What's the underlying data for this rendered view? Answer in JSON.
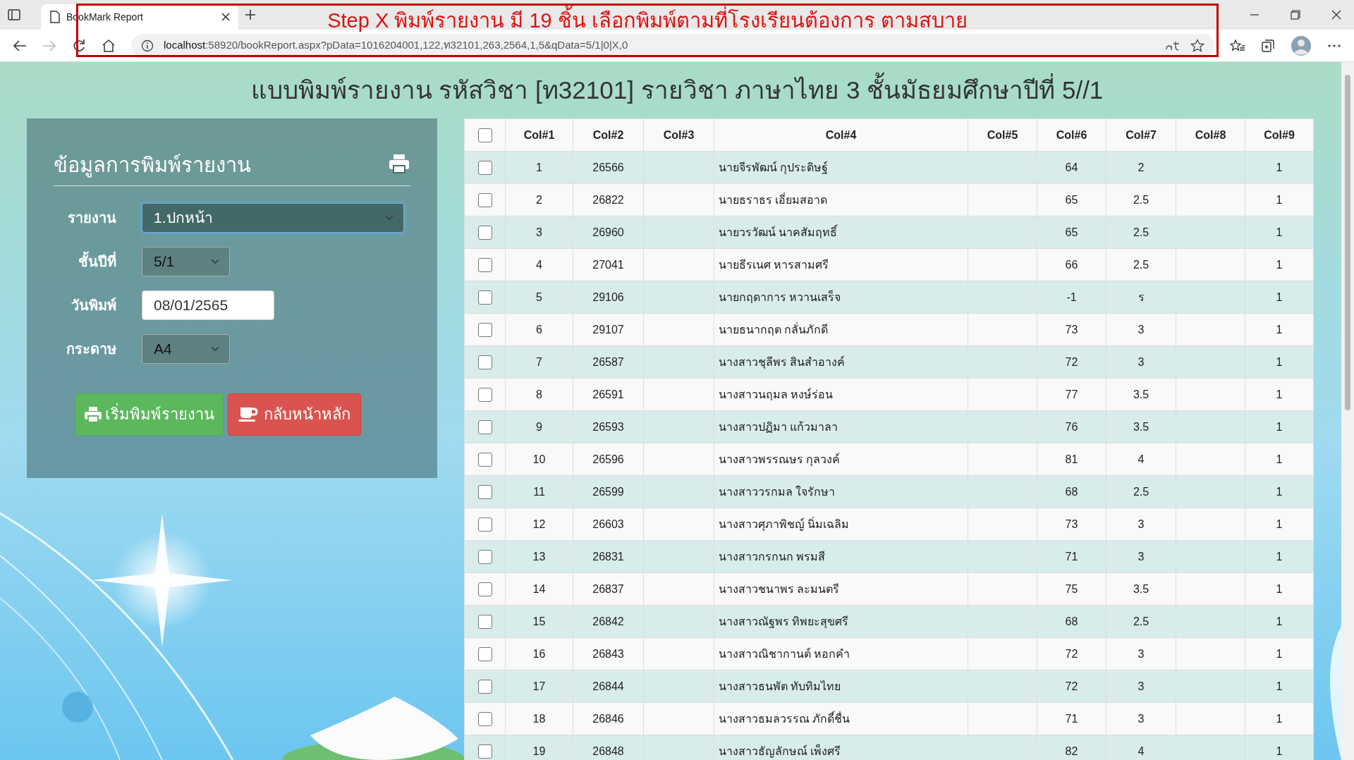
{
  "browser": {
    "tab_title": "BookMark Report",
    "url_host": "localhost",
    "url_rest": ":58920/bookReport.aspx?pData=1016204001,122,ท32101,263,2564,1,5&qData=5/1|0|X,0",
    "forward_disabled": true
  },
  "annotation": "Step X พิมพ์รายงาน มี 19 ชิ้น เลือกพิมพ์ตามที่โรงเรียนต้องการ ตามสบาย",
  "page_title": "แบบพิมพ์รายงาน รหัสวิชา [ท32101] รายวิชา ภาษาไทย 3 ชั้นมัธยมศึกษาปีที่ 5//1",
  "panel": {
    "title": "ข้อมูลการพิมพ์รายงาน",
    "fields": [
      {
        "kind": "select",
        "label": "รายงาน",
        "value": "1.ปกหน้า",
        "focused": true
      },
      {
        "kind": "select",
        "label": "ชั้นปีที่",
        "value": "5/1",
        "focused": false
      },
      {
        "kind": "date",
        "label": "วันพิมพ์",
        "value": "08/01/2565",
        "focused": false
      },
      {
        "kind": "select",
        "label": "กระดาษ",
        "value": "A4",
        "focused": false
      }
    ],
    "buttons": [
      {
        "kind": "print",
        "label": "เริ่มพิมพ์รายงาน"
      },
      {
        "kind": "home",
        "label": "กลับหน้าหลัก"
      }
    ]
  },
  "table": {
    "select_all_checked": false,
    "columns": [
      "Col#1",
      "Col#2",
      "Col#3",
      "Col#4",
      "Col#5",
      "Col#6",
      "Col#7",
      "Col#8",
      "Col#9"
    ],
    "rows": [
      {
        "checked": false,
        "col_1": "1",
        "col_2": "26566",
        "col_4": "นายจีรพัฒน์ กุประดิษฐ์",
        "col_6": "64",
        "col_7": "2",
        "col_9": "1"
      },
      {
        "checked": false,
        "col_1": "2",
        "col_2": "26822",
        "col_4": "นายธราธร เอี่ยมสอาด",
        "col_6": "65",
        "col_7": "2.5",
        "col_9": "1"
      },
      {
        "checked": false,
        "col_1": "3",
        "col_2": "26960",
        "col_4": "นายวรวัฒน์ นาคสัมฤทธิ์",
        "col_6": "65",
        "col_7": "2.5",
        "col_9": "1"
      },
      {
        "checked": false,
        "col_1": "4",
        "col_2": "27041",
        "col_4": "นายธีรเนศ หารสามศรี",
        "col_6": "66",
        "col_7": "2.5",
        "col_9": "1"
      },
      {
        "checked": false,
        "col_1": "5",
        "col_2": "29106",
        "col_4": "นายกฤดาการ หวานเสร็จ",
        "col_6": "-1",
        "col_7": "ร",
        "col_9": "1"
      },
      {
        "checked": false,
        "col_1": "6",
        "col_2": "29107",
        "col_4": "นายธนากฤต กลั่นภักดี",
        "col_6": "73",
        "col_7": "3",
        "col_9": "1"
      },
      {
        "checked": false,
        "col_1": "7",
        "col_2": "26587",
        "col_4": "นางสาวชุลีพร สินสำอางค์",
        "col_6": "72",
        "col_7": "3",
        "col_9": "1"
      },
      {
        "checked": false,
        "col_1": "8",
        "col_2": "26591",
        "col_4": "นางสาวนฤมล หงษ์ร่อน",
        "col_6": "77",
        "col_7": "3.5",
        "col_9": "1"
      },
      {
        "checked": false,
        "col_1": "9",
        "col_2": "26593",
        "col_4": "นางสาวปฏิมา แก้วมาลา",
        "col_6": "76",
        "col_7": "3.5",
        "col_9": "1"
      },
      {
        "checked": false,
        "col_1": "10",
        "col_2": "26596",
        "col_4": "นางสาวพรรณษร กุลวงค์",
        "col_6": "81",
        "col_7": "4",
        "col_9": "1"
      },
      {
        "checked": false,
        "col_1": "11",
        "col_2": "26599",
        "col_4": "นางสาววรกมล ใจรักษา",
        "col_6": "68",
        "col_7": "2.5",
        "col_9": "1"
      },
      {
        "checked": false,
        "col_1": "12",
        "col_2": "26603",
        "col_4": "นางสาวศุภาพิชญ์ นิ่มเฉลิม",
        "col_6": "73",
        "col_7": "3",
        "col_9": "1"
      },
      {
        "checked": false,
        "col_1": "13",
        "col_2": "26831",
        "col_4": "นางสาวกรกนก พรมสี",
        "col_6": "71",
        "col_7": "3",
        "col_9": "1"
      },
      {
        "checked": false,
        "col_1": "14",
        "col_2": "26837",
        "col_4": "นางสาวชนาพร ละมนตรี",
        "col_6": "75",
        "col_7": "3.5",
        "col_9": "1"
      },
      {
        "checked": false,
        "col_1": "15",
        "col_2": "26842",
        "col_4": "นางสาวณัฐพร ทิพยะสุขศรี",
        "col_6": "68",
        "col_7": "2.5",
        "col_9": "1"
      },
      {
        "checked": false,
        "col_1": "16",
        "col_2": "26843",
        "col_4": "นางสาวณิชากานต์ หอกคำ",
        "col_6": "72",
        "col_7": "3",
        "col_9": "1"
      },
      {
        "checked": false,
        "col_1": "17",
        "col_2": "26844",
        "col_4": "นางสาวธนพัต ทับทิมไทย",
        "col_6": "72",
        "col_7": "3",
        "col_9": "1"
      },
      {
        "checked": false,
        "col_1": "18",
        "col_2": "26846",
        "col_4": "นางสาวธมลวรรณ ภักดี์ชื่น",
        "col_6": "71",
        "col_7": "3",
        "col_9": "1"
      },
      {
        "checked": false,
        "col_1": "19",
        "col_2": "26848",
        "col_4": "นางสาวธัญลักษณ์ เพ็งศรี",
        "col_6": "82",
        "col_7": "4",
        "col_9": "1"
      }
    ]
  }
}
